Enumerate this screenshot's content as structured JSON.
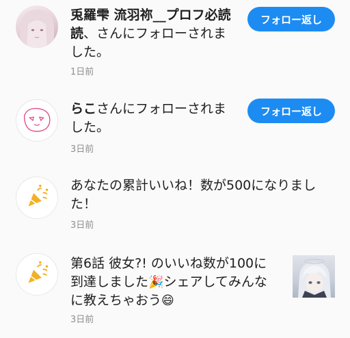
{
  "notifications": [
    {
      "name": "兎羅雫 流羽祢__プロフ必読",
      "line1_rest": "",
      "line2_prefix": "読",
      "line2_rest": "、さんにフォローされま",
      "line3": "した。",
      "time": "1日前",
      "button_label": "フォロー返し",
      "avatar_icon": "user-avatar-photo"
    },
    {
      "name": "らこ",
      "line1_rest": "さんにフォローされま",
      "line2": "した。",
      "time": "3日前",
      "button_label": "フォロー返し",
      "avatar_icon": "user-avatar-drawing"
    },
    {
      "line1": "あなたの累計いいね！数が500になりまし",
      "line2": "た！",
      "time": "3日前",
      "avatar_icon": "party-popper-icon"
    },
    {
      "line1": "第6話 彼女?! のいいね数が100に",
      "line2": "到達しました",
      "line2_emoji": "🎉",
      "line2_rest": "シェアしてみんな",
      "line3": "に教えちゃおう",
      "line3_emoji": "😄",
      "time": "3日前",
      "avatar_icon": "party-popper-icon",
      "thumbnail_icon": "episode-thumbnail"
    }
  ],
  "colors": {
    "accent": "#1d8cf2",
    "party_icon": "#f2b124",
    "timestamp": "#8e8e8e"
  }
}
